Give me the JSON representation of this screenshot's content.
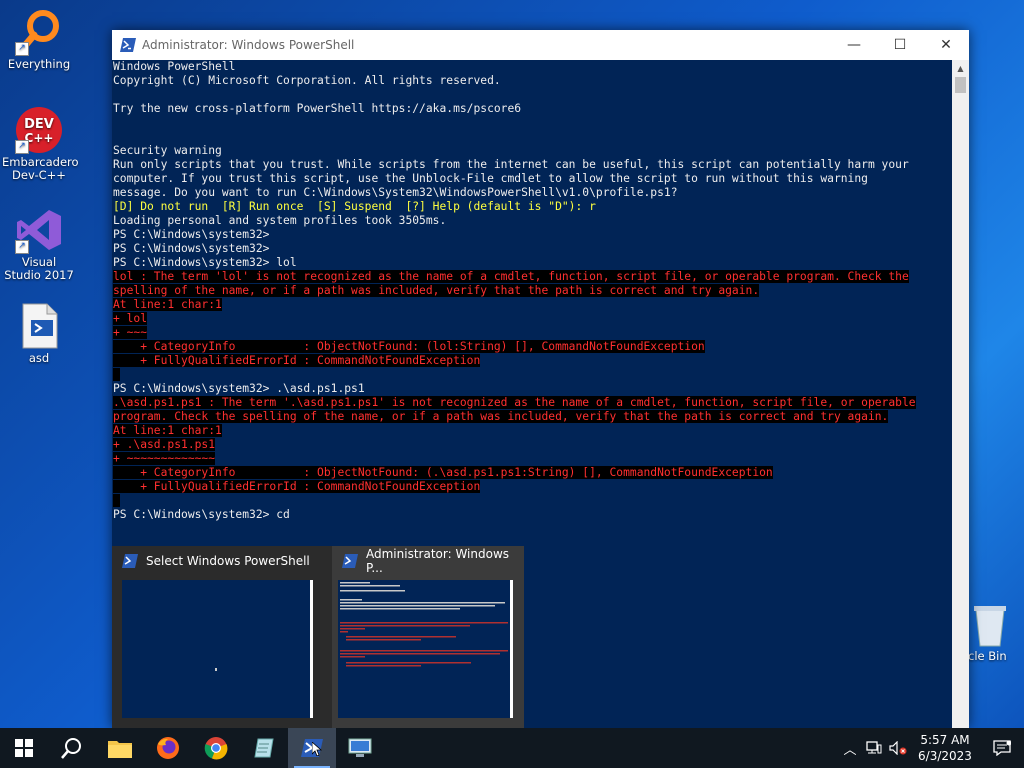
{
  "desktop": {
    "icons": [
      {
        "label": "Everything"
      },
      {
        "label": "Embarcadero Dev-C++"
      },
      {
        "label": "Visual Studio 2017"
      },
      {
        "label": "asd"
      },
      {
        "label": "cle Bin"
      }
    ]
  },
  "window": {
    "title": "Administrator: Windows PowerShell",
    "minimize": "—",
    "maximize": "☐",
    "close": "✕"
  },
  "console": {
    "lines": [
      {
        "t": "Windows PowerShell",
        "k": "n"
      },
      {
        "t": "Copyright (C) Microsoft Corporation. All rights reserved.",
        "k": "n"
      },
      {
        "t": "",
        "k": "n"
      },
      {
        "t": "Try the new cross-platform PowerShell https://aka.ms/pscore6",
        "k": "n"
      },
      {
        "t": "",
        "k": "n"
      },
      {
        "t": "",
        "k": "n"
      },
      {
        "t": "Security warning",
        "k": "n"
      },
      {
        "t": "Run only scripts that you trust. While scripts from the internet can be useful, this script can potentially harm your",
        "k": "n"
      },
      {
        "t": "computer. If you trust this script, use the Unblock-File cmdlet to allow the script to run without this warning",
        "k": "n"
      },
      {
        "t": "message. Do you want to run C:\\Windows\\System32\\WindowsPowerShell\\v1.0\\profile.ps1?",
        "k": "n"
      },
      {
        "t": "[D] Do not run  [R] Run once  [S] Suspend  [?] Help (default is \"D\"): r",
        "k": "w"
      },
      {
        "t": "Loading personal and system profiles took 3505ms.",
        "k": "n"
      },
      {
        "t": "PS C:\\Windows\\system32>",
        "k": "n"
      },
      {
        "t": "PS C:\\Windows\\system32>",
        "k": "n"
      },
      {
        "t": "PS C:\\Windows\\system32> lol",
        "k": "n"
      },
      {
        "t": "lol : The term 'lol' is not recognized as the name of a cmdlet, function, script file, or operable program. Check the",
        "k": "e"
      },
      {
        "t": "spelling of the name, or if a path was included, verify that the path is correct and try again.",
        "k": "e"
      },
      {
        "t": "At line:1 char:1",
        "k": "e"
      },
      {
        "t": "+ lol",
        "k": "e"
      },
      {
        "t": "+ ~~~",
        "k": "e"
      },
      {
        "t": "    + CategoryInfo          : ObjectNotFound: (lol:String) [], CommandNotFoundException",
        "k": "e"
      },
      {
        "t": "    + FullyQualifiedErrorId : CommandNotFoundException",
        "k": "e"
      },
      {
        "t": " ",
        "k": "e"
      },
      {
        "t": "PS C:\\Windows\\system32> .\\asd.ps1.ps1",
        "k": "n"
      },
      {
        "t": ".\\asd.ps1.ps1 : The term '.\\asd.ps1.ps1' is not recognized as the name of a cmdlet, function, script file, or operable",
        "k": "e"
      },
      {
        "t": "program. Check the spelling of the name, or if a path was included, verify that the path is correct and try again.",
        "k": "e"
      },
      {
        "t": "At line:1 char:1",
        "k": "e"
      },
      {
        "t": "+ .\\asd.ps1.ps1",
        "k": "e"
      },
      {
        "t": "+ ~~~~~~~~~~~~~",
        "k": "e"
      },
      {
        "t": "    + CategoryInfo          : ObjectNotFound: (.\\asd.ps1.ps1:String) [], CommandNotFoundException",
        "k": "e"
      },
      {
        "t": "    + FullyQualifiedErrorId : CommandNotFoundException",
        "k": "e"
      },
      {
        "t": " ",
        "k": "e"
      },
      {
        "t": "PS C:\\Windows\\system32> cd",
        "k": "n"
      }
    ]
  },
  "previews": [
    {
      "title": "Select Windows PowerShell"
    },
    {
      "title": "Administrator: Windows P..."
    }
  ],
  "taskbar": {
    "clock_time": "5:57 AM",
    "clock_date": "6/3/2023"
  },
  "colors": {
    "console_bg": "#012456",
    "error_fg": "#ff3030",
    "warn_fg": "#ffff40"
  }
}
